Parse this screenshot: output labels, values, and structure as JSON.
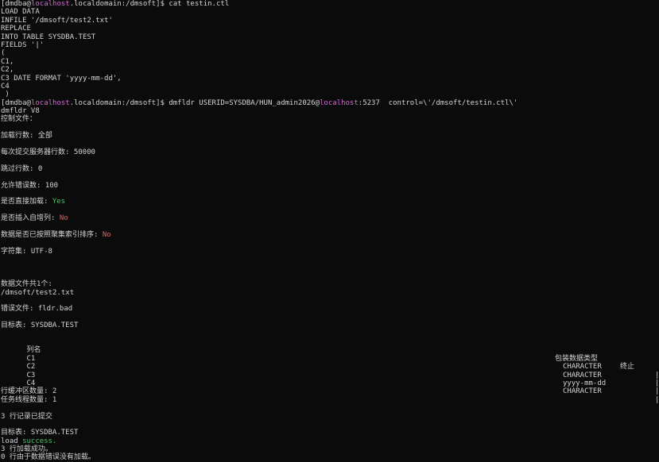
{
  "prompt1": {
    "open": "[dmdba@",
    "host": "localhost",
    "rest": ".localdomain:/dmsoft]$ cat testin.ctl"
  },
  "ctl_lines": [
    "LOAD DATA",
    "INFILE '/dmsoft/test2.txt'",
    "REPLACE",
    "INTO TABLE SYSDBA.TEST",
    "FIELDS '|'",
    "(",
    "C1,",
    "C2,",
    "C3 DATE FORMAT 'yyyy-mm-dd',",
    "C4",
    " )"
  ],
  "prompt2": {
    "open": "[dmdba@",
    "host": "localhost",
    "mid": ".localdomain:/dmsoft]$ dmfldr USERID=SYSDBA/HUN_admin2026@",
    "host2": "localhost",
    "tail": ":5237  control=\\'/dmsoft/testin.ctl\\'"
  },
  "version": "dmfldr V8",
  "control_file_label": "控制文件：",
  "load_rows": "加载行数: 全部",
  "commit_rows": "每次提交服务器行数: 50000",
  "skip_rows": "跳过行数: 0",
  "allowed_errors": "允许错误数: 100",
  "direct_load": {
    "label": "是否直接加载: ",
    "value": "Yes"
  },
  "insert_identity": {
    "label": "是否插入自增列: ",
    "value": "No"
  },
  "sorted_by_index": {
    "label": "数据是否已按照聚集索引排序: ",
    "value": "No"
  },
  "charset": "字符集: UTF-8",
  "data_files_label": "数据文件共1个:",
  "data_file": "/dmsoft/test2.txt",
  "error_file": "错误文件: fldr.bad",
  "target_table": "目标表: SYSDBA.TEST",
  "columns_header": {
    "name": "列名",
    "type": "包装数据类型",
    "end": "终止"
  },
  "columns": [
    {
      "name": "C1",
      "type": "CHARACTER",
      "end": "|"
    },
    {
      "name": "C2",
      "type": "CHARACTER",
      "end": "|"
    },
    {
      "name": "C3",
      "type": "yyyy-mm-dd",
      "end": "|"
    },
    {
      "name": "C4",
      "type": "CHARACTER",
      "end": "|"
    }
  ],
  "buffer_count": "行缓冲区数量: 2",
  "thread_count": "任务线程数量: 1",
  "committed": "3 行记录已提交",
  "target_table2": "目标表: SYSDBA.TEST",
  "load_status": {
    "prefix": "load ",
    "value": "success."
  },
  "load_rows_ok": "3 行加载成功。",
  "last_line": "0 行由于数据错误没有加载。",
  "colors": {
    "background": "#0b0b0c",
    "text": "#d4d4d4",
    "host": "#d06bd0",
    "success": "#4fc26a",
    "no": "#e0605c"
  }
}
